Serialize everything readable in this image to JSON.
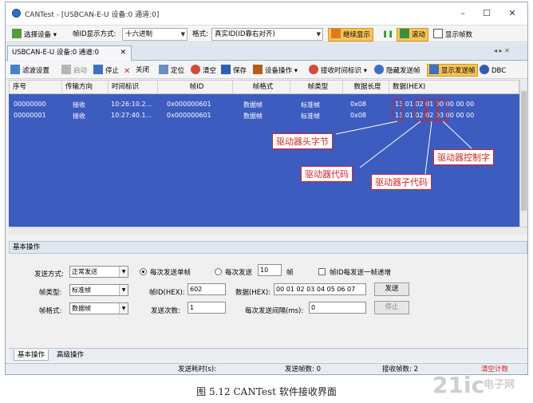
{
  "window": {
    "title": "CANTest - [USBCAN-E-U 设备:0 通道:0]",
    "controls": [
      "–",
      "☐",
      "✕"
    ]
  },
  "toolbar1": {
    "select_device": "选择设备",
    "frame_id_label": "帧ID显示方式:",
    "frame_id_value": "十六进制",
    "format_label": "格式:",
    "format_value": "真实ID(ID靠右对齐)",
    "follow_display": "继续显示",
    "scroll": "滚动",
    "show_frame_count": "显示帧数"
  },
  "tab": {
    "label": "USBCAN-E-U 设备:0 通道:0",
    "close": "✕",
    "nav": "◂ ▸ ✕"
  },
  "toolbar2": {
    "filter": "滤波设置",
    "start": "启动",
    "stop": "停止",
    "close": "关闭",
    "locate": "定位",
    "clear": "清空",
    "save": "保存",
    "device_ops": "设备操作",
    "recv_time": "接收时间标识",
    "hide_send": "隐藏发送帧",
    "show_send": "显示发送帧",
    "dbc": "DBC"
  },
  "grid": {
    "headers": [
      "序号",
      "传输方向",
      "时间标识",
      "帧ID",
      "帧格式",
      "帧类型",
      "数据长度",
      "数据(HEX)"
    ],
    "rows": [
      [
        "00000000",
        "接收",
        "10:26:10.2...",
        "0x000000601",
        "数据帧",
        "标准帧",
        "0x08",
        "13 01 02 01 00 00 00 00"
      ],
      [
        "00000001",
        "接收",
        "10:27:40.1...",
        "0x000000601",
        "数据帧",
        "标准帧",
        "0x08",
        "13 01 02 02 03 00 00 00"
      ]
    ]
  },
  "annotations": {
    "head_byte": "驱动器头字节",
    "control_byte": "驱动器控制字",
    "driver_code": "驱动器代码",
    "sub_code": "驱动器子代码"
  },
  "panel": {
    "title": "基本操作",
    "send_mode_label": "发送方式:",
    "send_mode_value": "正常发送",
    "radio_single": "每次发送单帧",
    "radio_multi": "每次发送",
    "multi_count": "10",
    "frame_unit": "帧",
    "increment_label": "帧ID每发送一帧递增",
    "frame_type_label": "帧类型:",
    "frame_type_value": "标准帧",
    "frame_id_label": "帧ID(HEX):",
    "frame_id_value": "602",
    "data_label": "数据(HEX):",
    "data_value": "00 01 02 03 04 05 06 07",
    "send_button": "发送",
    "frame_format_label": "帧格式:",
    "frame_format_value": "数据帧",
    "send_times_label": "发送次数:",
    "send_times_value": "1",
    "interval_label": "每次发送间隔(ms):",
    "interval_value": "0",
    "stop_button": "停止"
  },
  "bottom_tabs": [
    "基本操作",
    "高级操作"
  ],
  "status": {
    "send_time": "发送耗时(s):",
    "send_frames": "发送帧数: 0",
    "recv_frames": "接收帧数: 2",
    "clear_count": "清空计数"
  },
  "caption": "图 5.12 CANTest 软件接收界面",
  "watermark": "21ic 电子网",
  "colors": {
    "grid_bg": "#3c5cc0",
    "annotation": "#d62424",
    "highlight_button": "#f7c45a"
  }
}
